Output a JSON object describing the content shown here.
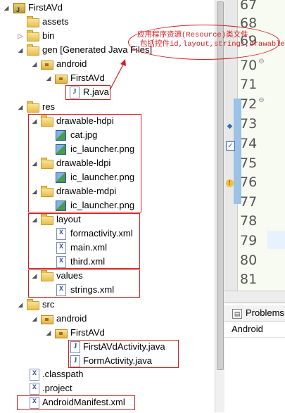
{
  "tree": {
    "project": "FirstAVd",
    "assets": "assets",
    "bin": "bin",
    "gen": "gen [Generated Java Files]",
    "gen_pkg_android": "android",
    "gen_pkg_firstavd": "FirstAVd",
    "r_java": "R.java",
    "res": "res",
    "drawable_hdpi": "drawable-hdpi",
    "cat_jpg": "cat.jpg",
    "ic_launcher_hdpi": "ic_launcher.png",
    "drawable_ldpi": "drawable-ldpi",
    "ic_launcher_ldpi": "ic_launcher.png",
    "drawable_mdpi": "drawable-mdpi",
    "ic_launcher_mdpi": "ic_launcher.png",
    "layout": "layout",
    "formactivity_xml": "formactivity.xml",
    "main_xml": "main.xml",
    "third_xml": "third.xml",
    "values": "values",
    "strings_xml": "strings.xml",
    "src": "src",
    "src_pkg_android": "android",
    "src_pkg_firstavd": "FirstAVd",
    "firstavd_activity": "FirstAVdActivity.java",
    "form_activity": "FormActivity.java",
    "classpath": ".classpath",
    "project_file": ".project",
    "manifest": "AndroidManifest.xml"
  },
  "editor": {
    "line_numbers": [
      "67",
      "68",
      "69",
      "70",
      "71",
      "72",
      "73",
      "74",
      "75",
      "76",
      "77",
      "78",
      "79",
      "80",
      "81"
    ]
  },
  "panel": {
    "tab_label": "Problems",
    "sub_label": "Android"
  },
  "annotation": {
    "line1": "应用程序资源(Resource)类文件,",
    "line2": "包括控件id,layout,strings,drawable"
  },
  "colors": {
    "annotation_red": "#d21f1f",
    "editor_bg": "#f7fbf2"
  }
}
